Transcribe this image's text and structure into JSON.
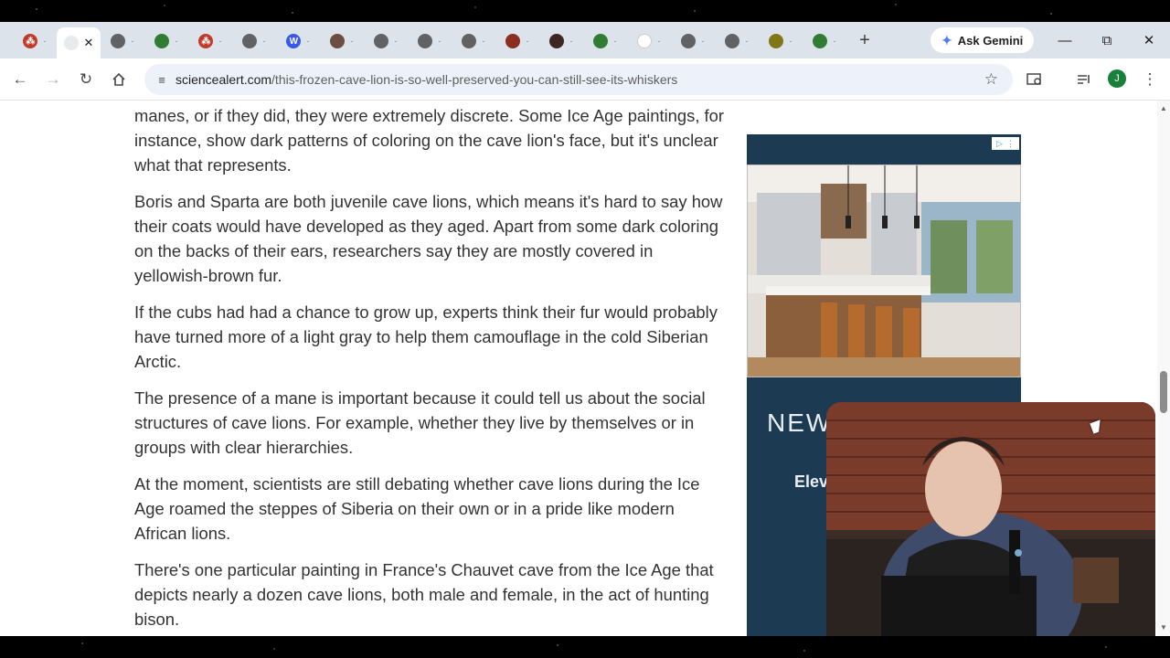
{
  "browser": {
    "tabs": [
      {
        "icon": "sciencealert-favicon",
        "color": "#c0392b",
        "glyph": "⁂"
      },
      {
        "icon": "active-tab-favicon",
        "color": "#e8eaed",
        "glyph": ""
      },
      {
        "icon": "globe-favicon",
        "color": "#5f6368",
        "glyph": ""
      },
      {
        "icon": "wikipedia-favicon",
        "color": "#2e7d32",
        "glyph": ""
      },
      {
        "icon": "sciencealert-favicon",
        "color": "#c0392b",
        "glyph": "⁂"
      },
      {
        "icon": "globe-favicon",
        "color": "#5f6368",
        "glyph": ""
      },
      {
        "icon": "wordpress-favicon",
        "color": "#3858e9",
        "glyph": "W"
      },
      {
        "icon": "bird-favicon",
        "color": "#6d4c41",
        "glyph": ""
      },
      {
        "icon": "globe-favicon",
        "color": "#5f6368",
        "glyph": ""
      },
      {
        "icon": "globe-favicon",
        "color": "#5f6368",
        "glyph": ""
      },
      {
        "icon": "image-favicon",
        "color": "#616161",
        "glyph": ""
      },
      {
        "icon": "ark-favicon",
        "color": "#8b2e1f",
        "glyph": ""
      },
      {
        "icon": "circle-logo-favicon",
        "color": "#3e2723",
        "glyph": ""
      },
      {
        "icon": "wikipedia-favicon",
        "color": "#2e7d32",
        "glyph": ""
      },
      {
        "icon": "blank-favicon",
        "color": "#ffffff",
        "glyph": ""
      },
      {
        "icon": "globe-favicon",
        "color": "#5f6368",
        "glyph": ""
      },
      {
        "icon": "globe-favicon",
        "color": "#5f6368",
        "glyph": ""
      },
      {
        "icon": "park-favicon",
        "color": "#827717",
        "glyph": ""
      },
      {
        "icon": "wikipedia-favicon",
        "color": "#2e7d32",
        "glyph": ""
      }
    ],
    "new_tab": "+",
    "ask_gemini": "Ask Gemini",
    "url_host": "sciencealert.com",
    "url_path": "/this-frozen-cave-lion-is-so-well-preserved-you-can-still-see-its-whiskers",
    "profile_initial": "J"
  },
  "article": {
    "paragraphs": [
      "manes, or if they did, they were extremely discrete. Some Ice Age paintings, for instance, show dark patterns of coloring on the cave lion's face, but it's unclear what that represents.",
      "Boris and Sparta are both juvenile cave lions, which means it's hard to say how their coats would have developed as they aged. Apart from some dark coloring on the backs of their ears, researchers say they are mostly covered in yellowish-brown fur.",
      "If the cubs had had a chance to grow up, experts think their fur would probably have turned more of a light gray to help them camouflage in the cold Siberian Arctic.",
      "The presence of a mane is important because it could tell us about the social structures of cave lions. For example, whether they live by themselves or in groups with clear hierarchies.",
      "At the moment, scientists are still debating whether cave lions during the Ice Age roamed the steppes of Siberia on their own or in a pride like modern African lions.",
      "There's one particular painting in France's Chauvet cave from the Ice Age that depicts nearly a dozen cave lions, both male and female, in the act of hunting bison."
    ]
  },
  "ad": {
    "headline": "NEW",
    "subline": "Elev"
  }
}
